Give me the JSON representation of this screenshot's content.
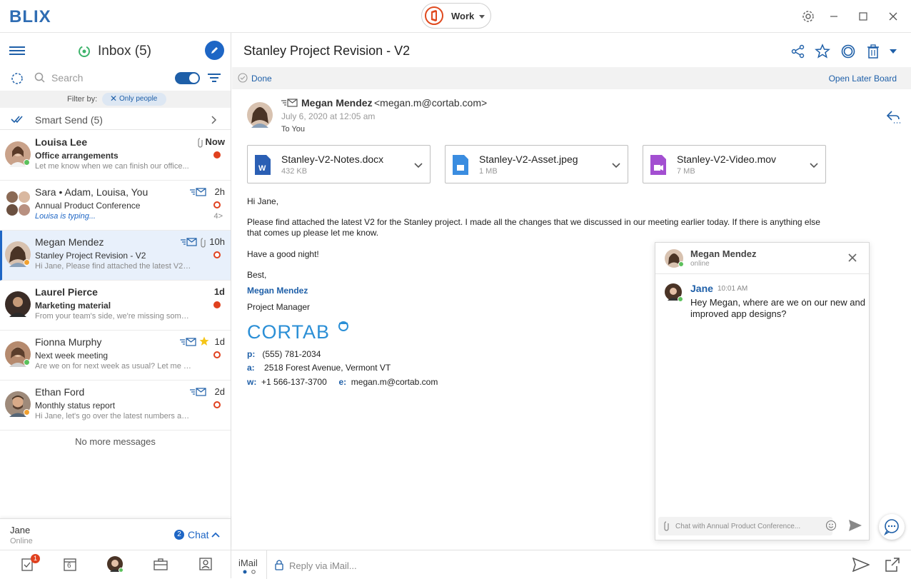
{
  "app": {
    "logo": "BLIX",
    "account_label": "Work"
  },
  "inbox": {
    "title": "Inbox (5)",
    "search_placeholder": "Search",
    "filter_label": "Filter by:",
    "filter_chip": "Only people",
    "smart_send": "Smart Send (5)",
    "no_more": "No more messages",
    "messages": [
      {
        "sender": "Louisa Lee",
        "subject": "Office arrangements",
        "preview": "Let me know when we can finish our office...",
        "time": "Now",
        "unread": true,
        "status": "online"
      },
      {
        "sender": "Sara • Adam, Louisa, You",
        "subject": "Annual Product Conference",
        "preview": "Louisa is typing...",
        "time": "2h",
        "unread": false,
        "count": "4>"
      },
      {
        "sender": "Megan Mendez",
        "subject": "Stanley Project Revision - V2",
        "preview": "Hi Jane, Please find attached the latest V2 for...",
        "time": "10h",
        "unread": false,
        "selected": true
      },
      {
        "sender": "Laurel Pierce",
        "subject": "Marketing material",
        "preview": "From your team's side, we're missing some doc...",
        "time": "1d",
        "unread": true
      },
      {
        "sender": "Fionna Murphy",
        "subject": "Next week meeting",
        "preview": "Are we on for next week as usual? Let me know...",
        "time": "1d",
        "unread": false
      },
      {
        "sender": "Ethan Ford",
        "subject": "Monthly status report",
        "preview": "Hi Jane, let's go over the latest numbers as soon...",
        "time": "2d",
        "unread": false
      }
    ]
  },
  "chat_footer": {
    "user": "Jane",
    "status": "Online",
    "badge": "2",
    "label": "Chat"
  },
  "bottom_nav": {
    "tasks_badge": "1",
    "calendar_day": "6"
  },
  "message": {
    "subject": "Stanley Project Revision - V2",
    "done_label": "Done",
    "later_board": "Open Later Board",
    "from_name": "Megan Mendez",
    "from_email": "<megan.m@cortab.com>",
    "date": "July 6, 2020 at 12:05 am",
    "to": "To You",
    "attachments": [
      {
        "name": "Stanley-V2-Notes.docx",
        "size": "432 KB",
        "type": "docx",
        "color": "#2b5fb4"
      },
      {
        "name": "Stanley-V2-Asset.jpeg",
        "size": "1 MB",
        "type": "jpeg",
        "color": "#3b8de0"
      },
      {
        "name": "Stanley-V2-Video.mov",
        "size": "7 MB",
        "type": "mov",
        "color": "#a34fd1"
      }
    ],
    "body": {
      "greeting": "Hi Jane,",
      "para1": "Please find attached the latest V2 for the Stanley project. I made all the changes that we discussed in our meeting earlier today. If there is anything else that comes up please let me know.",
      "para2": "Have a good night!",
      "closing": "Best,"
    },
    "signature": {
      "name": "Megan Mendez",
      "title": "Project Manager",
      "company": "CORTAB",
      "phone_label": "p:",
      "phone": "(555) 781-2034",
      "address_label": "a:",
      "address": "2518  Forest Avenue, Vermont VT",
      "web_label": "w:",
      "web": "+1 566-137-3700",
      "email_label": "e:",
      "email": "megan.m@cortab.com"
    }
  },
  "chat_popup": {
    "name": "Megan Mendez",
    "status": "online",
    "msg_sender": "Jane",
    "msg_time": "10:01 AM",
    "msg_text": "Hey Megan, where are we on our new and improved app designs?",
    "input_placeholder": "Chat with Annual Product Conference..."
  },
  "reply": {
    "mode": "iMail",
    "placeholder": "Reply via iMail..."
  }
}
